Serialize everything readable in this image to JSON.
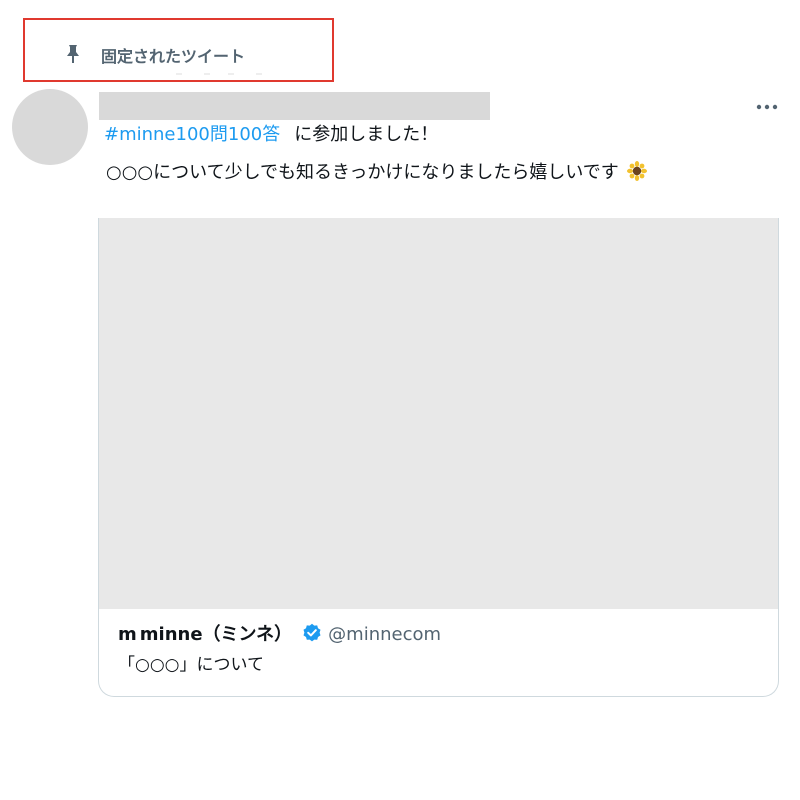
{
  "pinned": {
    "label": "固定されたツイート",
    "icon": "pin-icon"
  },
  "tweet": {
    "hashtag": "#minne100問100答",
    "line1_rest": "に参加しました！",
    "line2": "○○○について少しでも知るきっかけになりましたら嬉しいです",
    "emoji_icon": "sunflower-icon",
    "more_icon": "more-icon"
  },
  "card": {
    "logo": "m",
    "author_name": "minne（ミンネ）",
    "verified_icon": "verified-badge-icon",
    "handle": "@minnecom",
    "text": "「○○○」について"
  },
  "colors": {
    "highlight_border": "#e0392f",
    "hashtag": "#1d9bf0",
    "verified": "#1d9bf0",
    "placeholder": "#d9d9d9",
    "card_image": "#e8e8e8"
  }
}
